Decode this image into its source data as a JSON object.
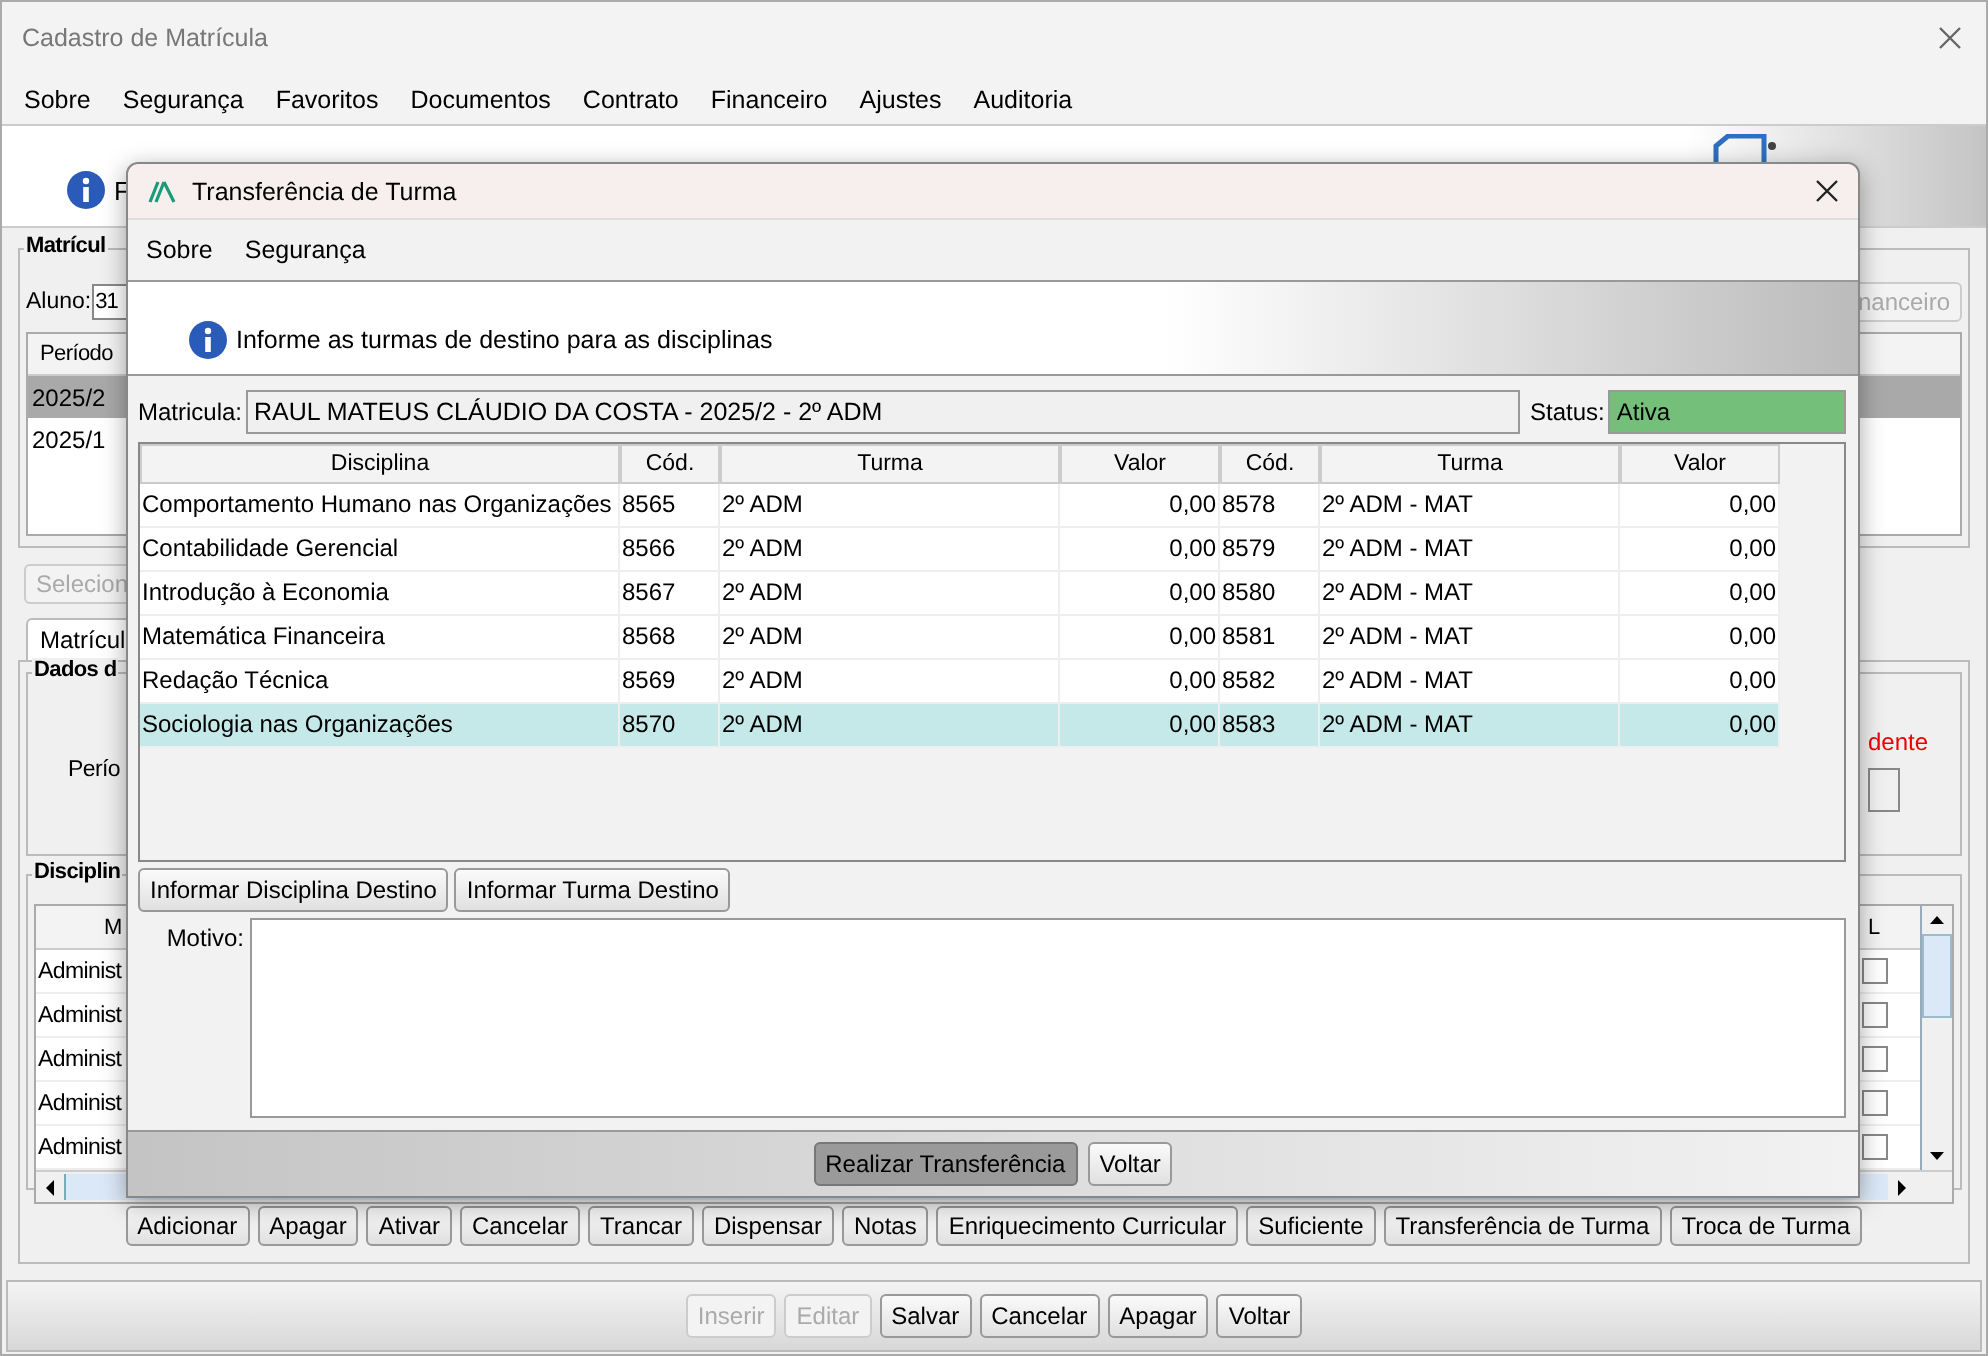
{
  "window": {
    "title": "Cadastro de Matrícula"
  },
  "menu": [
    "Sobre",
    "Segurança",
    "Favoritos",
    "Documentos",
    "Contrato",
    "Financeiro",
    "Ajustes",
    "Auditoria"
  ],
  "header": {
    "message": "F"
  },
  "matricula_group": {
    "title": "Matrícul",
    "aluno_label": "Aluno:",
    "aluno_value": "31",
    "right_button": {
      "label": "nanceiro",
      "disabled": true
    },
    "column": "Período",
    "rows": [
      {
        "periodo": "2025/2",
        "selected": true
      },
      {
        "periodo": "2025/1",
        "selected": false
      }
    ],
    "select_button": {
      "label": "Selecion",
      "disabled": true
    }
  },
  "tabs": [
    {
      "label": "Matrícul",
      "selected": true
    }
  ],
  "dados_group": {
    "title": "Dados d",
    "periodo_label": "Perío",
    "status_text": "dente"
  },
  "disciplinas_group": {
    "title": "Disciplin",
    "column_1": "M",
    "column_2": "L",
    "rows": [
      {
        "column_1": "Administ",
        "checked": false
      },
      {
        "column_1": "Administ",
        "checked": false
      },
      {
        "column_1": "Administ",
        "checked": false
      },
      {
        "column_1": "Administ",
        "checked": false
      },
      {
        "column_1": "Administ",
        "checked": false
      }
    ]
  },
  "action_buttons": [
    "Adicionar",
    "Apagar",
    "Ativar",
    "Cancelar",
    "Trancar",
    "Dispensar",
    "Notas",
    "Enriquecimento Curricular",
    "Suficiente",
    "Transferência de Turma",
    "Troca de Turma"
  ],
  "footer_buttons": [
    {
      "label": "Inserir",
      "disabled": true
    },
    {
      "label": "Editar",
      "disabled": true
    },
    {
      "label": "Salvar",
      "disabled": false
    },
    {
      "label": "Cancelar",
      "disabled": false
    },
    {
      "label": "Apagar",
      "disabled": false
    },
    {
      "label": "Voltar",
      "disabled": false
    }
  ],
  "dialog": {
    "title": "Transferência de Turma",
    "menu": [
      "Sobre",
      "Segurança"
    ],
    "info": "Informe as turmas de destino para as disciplinas",
    "matricula_label": "Matricula:",
    "matricula_value": "RAUL MATEUS CLÁUDIO DA COSTA - 2025/2 - 2º ADM",
    "status_label": "Status:",
    "status_value": "Ativa",
    "columns": [
      "Disciplina",
      "Cód.",
      "Turma",
      "Valor",
      "Cód.",
      "Turma",
      "Valor"
    ],
    "rows": [
      {
        "disciplina": "Comportamento Humano nas Organizações",
        "cod": "8565",
        "turma": "2º ADM",
        "valor": "0,00",
        "cod_destino": "8578",
        "turma_destino": "2º ADM - MAT",
        "valor_destino": "0,00",
        "selected": false
      },
      {
        "disciplina": "Contabilidade Gerencial",
        "cod": "8566",
        "turma": "2º ADM",
        "valor": "0,00",
        "cod_destino": "8579",
        "turma_destino": "2º ADM - MAT",
        "valor_destino": "0,00",
        "selected": false
      },
      {
        "disciplina": "Introdução à Economia",
        "cod": "8567",
        "turma": "2º ADM",
        "valor": "0,00",
        "cod_destino": "8580",
        "turma_destino": "2º ADM - MAT",
        "valor_destino": "0,00",
        "selected": false
      },
      {
        "disciplina": "Matemática Financeira",
        "cod": "8568",
        "turma": "2º ADM",
        "valor": "0,00",
        "cod_destino": "8581",
        "turma_destino": "2º ADM - MAT",
        "valor_destino": "0,00",
        "selected": false
      },
      {
        "disciplina": "Redação Técnica",
        "cod": "8569",
        "turma": "2º ADM",
        "valor": "0,00",
        "cod_destino": "8582",
        "turma_destino": "2º ADM - MAT",
        "valor_destino": "0,00",
        "selected": false
      },
      {
        "disciplina": "Sociologia nas Organizações",
        "cod": "8570",
        "turma": "2º ADM",
        "valor": "0,00",
        "cod_destino": "8583",
        "turma_destino": "2º ADM - MAT",
        "valor_destino": "0,00",
        "selected": true
      }
    ],
    "table_buttons": [
      "Informar Disciplina Destino",
      "Informar Turma Destino"
    ],
    "motivo_label": "Motivo:",
    "bottom_buttons": [
      {
        "label": "Realizar Transferência",
        "kind": "default"
      },
      {
        "label": "Voltar",
        "kind": "normal"
      }
    ]
  }
}
